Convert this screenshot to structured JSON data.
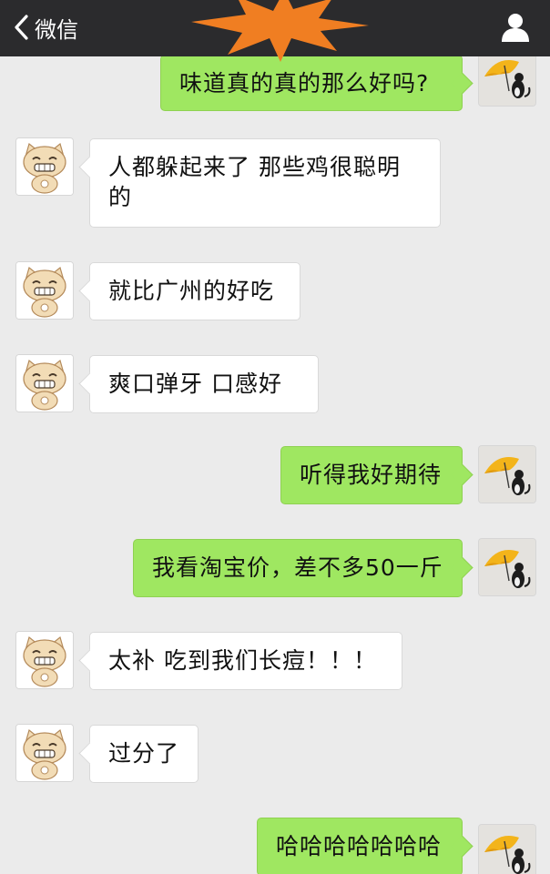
{
  "navbar": {
    "back_label": "微信",
    "back_icon": "chevron-left-icon",
    "contact_icon": "person-icon",
    "bg_color": "#2b2b2d"
  },
  "colors": {
    "outgoing_bubble": "#9fe761",
    "incoming_bubble": "#ffffff",
    "background": "#ebebeb"
  },
  "messages": [
    {
      "direction": "out",
      "text": "味道真的真的那么好吗?"
    },
    {
      "direction": "in",
      "text": "人都躲起来了  那些鸡很聪明的"
    },
    {
      "direction": "in",
      "text": "就比广州的好吃"
    },
    {
      "direction": "in",
      "text": "爽口弹牙  口感好"
    },
    {
      "direction": "out",
      "text": "听得我好期待"
    },
    {
      "direction": "out",
      "text": "我看淘宝价，差不多50一斤"
    },
    {
      "direction": "in",
      "text": "太补  吃到我们长痘！！！"
    },
    {
      "direction": "in",
      "text": "过分了"
    },
    {
      "direction": "out",
      "text": "哈哈哈哈哈哈哈"
    }
  ]
}
